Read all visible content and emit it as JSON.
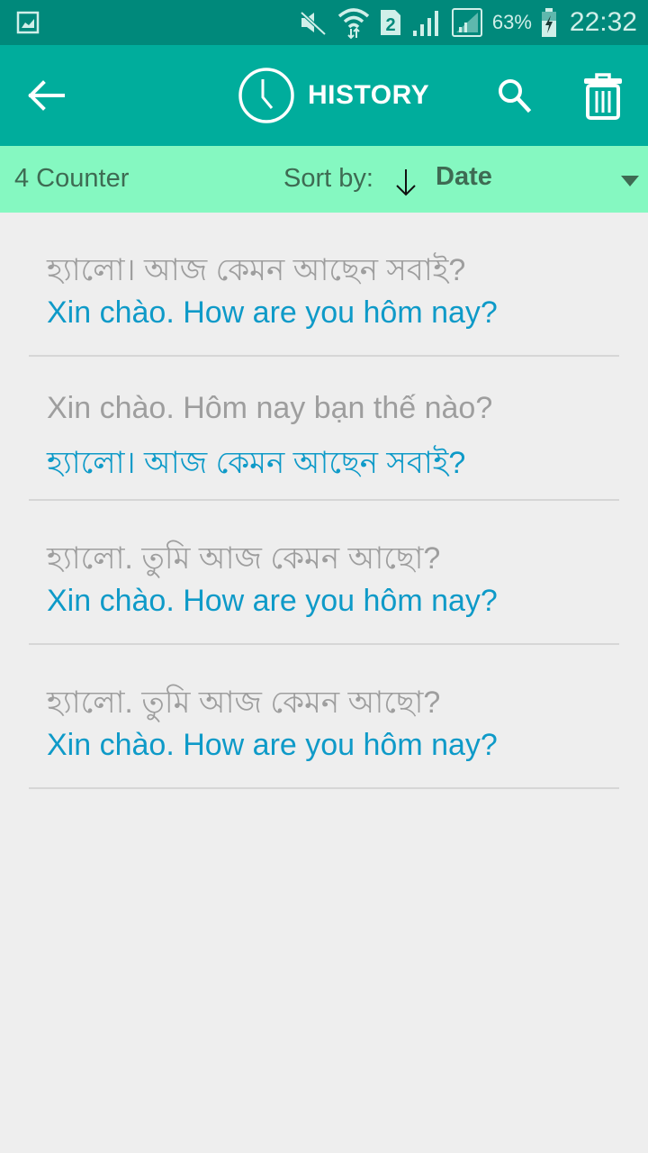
{
  "status_bar": {
    "icons": [
      "gallery-icon",
      "mute-icon",
      "wifi-icon",
      "sim2-icon",
      "signal-icon",
      "signal-icon-2",
      "battery-charging-icon"
    ],
    "battery": "63%",
    "time": "22:32"
  },
  "app_bar": {
    "title": "HISTORY",
    "icons": {
      "back": "arrow-left-icon",
      "clock": "clock-icon",
      "search": "search-icon",
      "delete": "trash-icon"
    }
  },
  "sort_bar": {
    "counter": "4 Counter",
    "sort_label": "Sort by:",
    "sort_value": "Date",
    "colors": {
      "background": "#85f8c1",
      "text": "#3e6b53"
    }
  },
  "history": [
    {
      "source": "হ্যালো। আজ কেমন আছেন সবাই?",
      "translation": "Xin chào. How are you hôm nay?"
    },
    {
      "source": "Xin chào. Hôm nay bạn thế nào?",
      "translation": "হ্যালো। আজ কেমন আছেন সবাই?"
    },
    {
      "source": "হ্যালো. তুমি আজ কেমন আছো?",
      "translation": "Xin chào. How are you hôm nay?"
    },
    {
      "source": "হ্যালো. তুমি আজ কেমন আছো?",
      "translation": "Xin chào. How are you hôm nay?"
    }
  ],
  "colors": {
    "status_bar": "#00897b",
    "app_bar": "#00ad9c",
    "source_text": "#9e9e9e",
    "translation_text": "#0e9ac8"
  }
}
